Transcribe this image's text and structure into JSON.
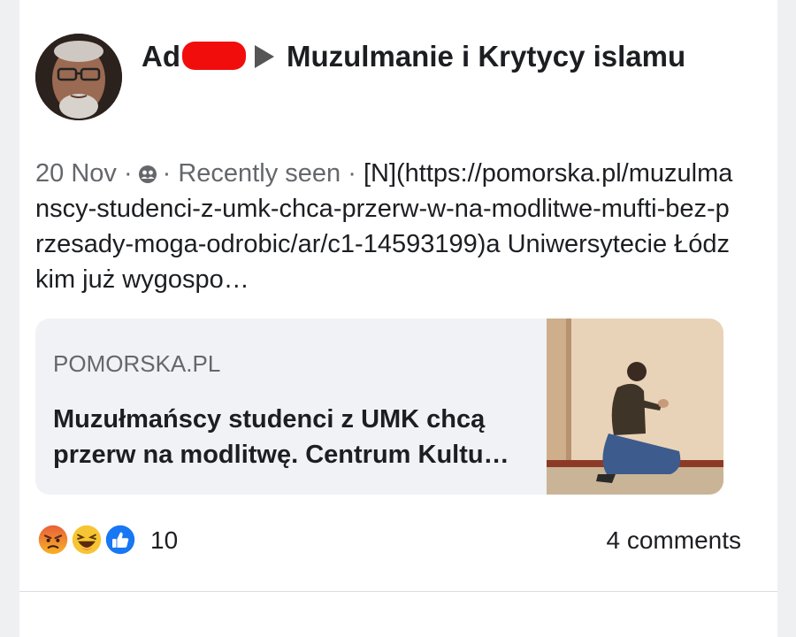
{
  "post": {
    "author_prefix": "Ad",
    "group_name": "Muzulmanie i Krytycy islamu",
    "date": "20 Nov",
    "separator": "·",
    "seen_status": "Recently seen",
    "body_text": "[N](https://pomorska.pl/muzulmanscy-studenci-z-umk-chca-przerw-w-na-modlitwe-mufti-bez-przesady-moga-odrobic/ar/c1-14593199)a Uniwersytecie Łódzkim już wygospo…"
  },
  "link_preview": {
    "domain": "POMORSKA.PL",
    "headline": "Muzułmańscy studenci z UMK chcą przerw na modlitwę. Centrum Kultu…"
  },
  "engagement": {
    "reaction_icons": [
      "angry-reaction-icon",
      "haha-reaction-icon",
      "like-reaction-icon"
    ],
    "reaction_count": "10",
    "comments_label": "4 comments"
  },
  "colors": {
    "page_bg": "#eff0f2",
    "card_bg": "#ffffff",
    "preview_bg": "#f0f2f5",
    "muted_text": "#65676b",
    "redaction": "#f20d0d",
    "like_blue": "#1877f2"
  }
}
